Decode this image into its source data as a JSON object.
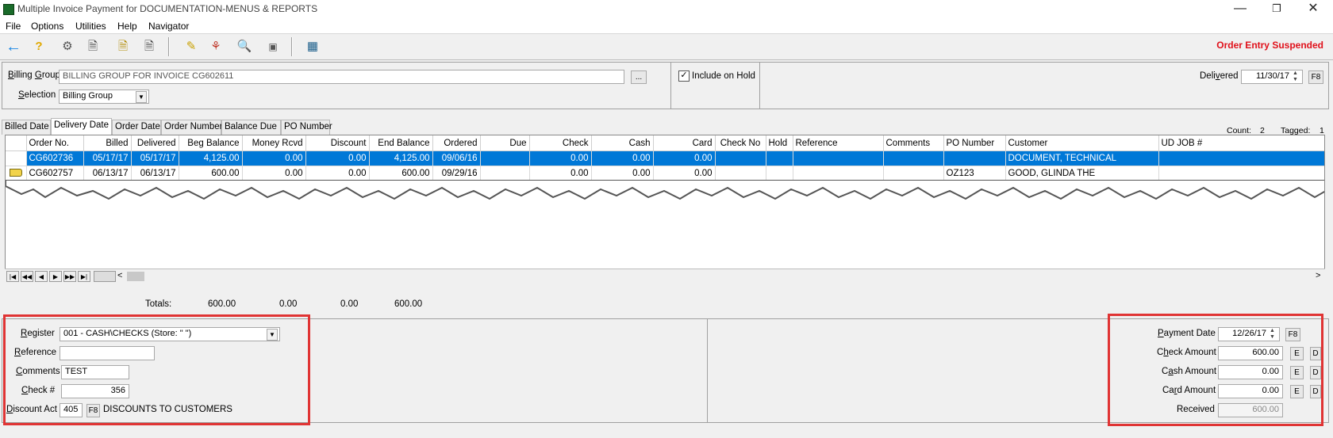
{
  "window": {
    "title": "Multiple Invoice Payment for DOCUMENTATION-MENUS & REPORTS"
  },
  "menu": [
    "File",
    "Options",
    "Utilities",
    "Help",
    "Navigator"
  ],
  "toolbar": {
    "status": "Order Entry Suspended",
    "icons": [
      "back-arrow-icon",
      "help-icon",
      "tools-icon",
      "document-add-icon",
      "document-edit-icon",
      "document-remove-icon",
      "tag-icon",
      "flowchart-icon",
      "magnifier-icon",
      "stamp-icon",
      "calculator-icon"
    ]
  },
  "billing": {
    "group_label": "Billing Group",
    "group_value": "BILLING GROUP FOR INVOICE CG602611",
    "browse": "...",
    "selection_label": "Selection",
    "selection_value": "Billing Group",
    "include_on_hold": "Include on Hold",
    "include_on_hold_checked": true,
    "delivered_label": "Delivered",
    "delivered_value": "11/30/17",
    "f8": "F8"
  },
  "tabs": [
    "Billed Date",
    "Delivery Date",
    "Order Date",
    "Order Number",
    "Balance Due",
    "PO Number"
  ],
  "active_tab": "Delivery Date",
  "counts": {
    "count_label": "Count:",
    "count": "2",
    "tagged_label": "Tagged:",
    "tagged": "1"
  },
  "grid": {
    "columns": [
      "Order No.",
      "Billed",
      "Delivered",
      "Beg Balance",
      "Money Rcvd",
      "Discount",
      "End Balance",
      "Ordered",
      "Due",
      "Check",
      "Cash",
      "Card",
      "Check No",
      "Hold",
      "Reference",
      "Comments",
      "PO Number",
      "Customer",
      "UD JOB #"
    ],
    "rows": [
      [
        "CG602736",
        "05/17/17",
        "05/17/17",
        "4,125.00",
        "0.00",
        "0.00",
        "4,125.00",
        "09/06/16",
        "",
        "0.00",
        "0.00",
        "0.00",
        "",
        "",
        "",
        "",
        "",
        "DOCUMENT, TECHNICAL",
        ""
      ],
      [
        "CG602757",
        "06/13/17",
        "06/13/17",
        "600.00",
        "0.00",
        "0.00",
        "600.00",
        "09/29/16",
        "",
        "0.00",
        "0.00",
        "0.00",
        "",
        "",
        "",
        "",
        "OZ123",
        "GOOD, GLINDA THE",
        ""
      ]
    ]
  },
  "totals": {
    "label": "Totals:",
    "beg_balance": "600.00",
    "money_rcvd": "0.00",
    "discount": "0.00",
    "end_balance": "600.00"
  },
  "payment": {
    "register_label": "Register",
    "register_value": "001 - CASH\\CHECKS (Store: \" \")",
    "reference_label": "Reference",
    "reference_value": "",
    "comments_label": "Comments",
    "comments_value": "TEST",
    "check_label": "Check #",
    "check_value": "356",
    "discount_label": "Discount Act",
    "discount_value": "405",
    "discount_f8": "F8",
    "discount_desc": "DISCOUNTS TO CUSTOMERS"
  },
  "amounts": {
    "payment_date_label": "Payment Date",
    "payment_date": "12/26/17",
    "f8": "F8",
    "check_label": "Check Amount",
    "check_amount": "600.00",
    "cash_label": "Cash Amount",
    "cash_amount": "0.00",
    "card_label": "Card Amount",
    "card_amount": "0.00",
    "received_label": "Received",
    "received": "600.00",
    "e": "E",
    "d": "D"
  }
}
